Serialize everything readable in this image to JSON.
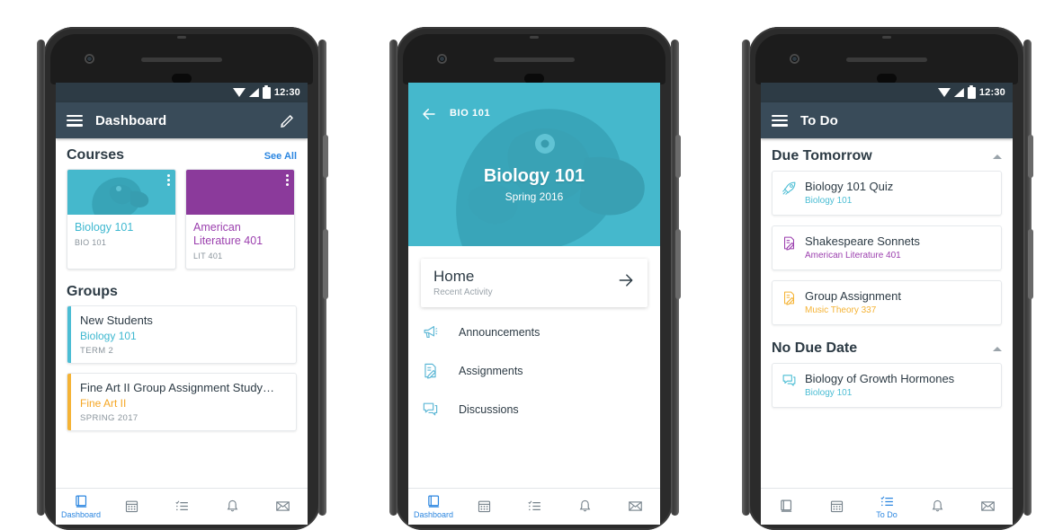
{
  "colors": {
    "statusbar": "#2d3b45",
    "appbar": "#394b59",
    "biology_teal": "#45b8cc",
    "literature_purple": "#8b3a9b",
    "fineart_gold": "#f5a623",
    "link_blue": "#2b86e0",
    "text_dark": "#2d3b45",
    "muted": "#8a949c"
  },
  "phones": [
    {
      "id": "dashboard",
      "statusbar": {
        "time": "12:30",
        "icons": [
          "wifi-icon",
          "signal-icon",
          "battery-icon"
        ]
      },
      "appbar": {
        "menu_icon": "hamburger-icon",
        "title": "Dashboard",
        "action_icon": "pencil-icon"
      },
      "courses_section": {
        "heading": "Courses",
        "see_all": "See All",
        "cards": [
          {
            "name": "Biology 101",
            "code": "BIO 101",
            "color": "#45b8cc",
            "name_color": "#3eb8d0",
            "has_image": true,
            "overflow_icon": "kebab-icon"
          },
          {
            "name": "American Literature 401",
            "code": "LIT 401",
            "color": "#8b3a9b",
            "name_color": "#9b3fae",
            "has_image": false,
            "overflow_icon": "kebab-icon"
          }
        ]
      },
      "groups_section": {
        "heading": "Groups",
        "items": [
          {
            "name": "New Students",
            "course": "Biology 101",
            "term": "TERM 2",
            "color": "#4bbdd4"
          },
          {
            "name": "Fine Art II Group Assignment Study…",
            "course": "Fine Art II",
            "term": "SPRING 2017",
            "color": "#f5b335"
          }
        ]
      },
      "bottomnav": {
        "items": [
          {
            "icon": "dashboard-icon",
            "label": "Dashboard",
            "active": true
          },
          {
            "icon": "calendar-icon",
            "label": "",
            "active": false
          },
          {
            "icon": "todo-list-icon",
            "label": "",
            "active": false
          },
          {
            "icon": "bell-icon",
            "label": "",
            "active": false
          },
          {
            "icon": "envelope-icon",
            "label": "",
            "active": false
          }
        ]
      }
    },
    {
      "id": "course-detail",
      "hero": {
        "back_icon": "arrow-left-icon",
        "breadcrumb": "BIO 101",
        "title": "Biology 101",
        "subtitle": "Spring 2016",
        "color": "#45b8cc"
      },
      "home_card": {
        "title": "Home",
        "subtitle": "Recent Activity",
        "action_icon": "arrow-right-icon"
      },
      "menu": [
        {
          "icon": "announcement-icon",
          "label": "Announcements"
        },
        {
          "icon": "assignment-icon",
          "label": "Assignments"
        },
        {
          "icon": "discussion-icon",
          "label": "Discussions"
        }
      ],
      "bottomnav": {
        "items": [
          {
            "icon": "dashboard-icon",
            "label": "Dashboard",
            "active": true
          },
          {
            "icon": "calendar-icon",
            "label": "",
            "active": false
          },
          {
            "icon": "todo-list-icon",
            "label": "",
            "active": false
          },
          {
            "icon": "bell-icon",
            "label": "",
            "active": false
          },
          {
            "icon": "envelope-icon",
            "label": "",
            "active": false
          }
        ]
      }
    },
    {
      "id": "todo",
      "statusbar": {
        "time": "12:30",
        "icons": [
          "wifi-icon",
          "signal-icon",
          "battery-icon"
        ]
      },
      "appbar": {
        "menu_icon": "hamburger-icon",
        "title": "To Do",
        "action_icon": ""
      },
      "sections": [
        {
          "heading": "Due Tomorrow",
          "collapse_icon": "caret-up-icon",
          "items": [
            {
              "icon": "quiz-rocket-icon",
              "title": "Biology 101 Quiz",
              "course": "Biology 101",
              "color": "#4bbdd4"
            },
            {
              "icon": "assignment-icon",
              "title": "Shakespeare Sonnets",
              "course": "American Literature 401",
              "color": "#9b3fae"
            },
            {
              "icon": "assignment-icon",
              "title": "Group Assignment",
              "course": "Music Theory 337",
              "color": "#f5b335"
            }
          ]
        },
        {
          "heading": "No Due Date",
          "collapse_icon": "caret-up-icon",
          "items": [
            {
              "icon": "discussion-icon",
              "title": "Biology of Growth Hormones",
              "course": "Biology 101",
              "color": "#4bbdd4"
            }
          ]
        }
      ],
      "bottomnav": {
        "items": [
          {
            "icon": "dashboard-icon",
            "label": "",
            "active": false
          },
          {
            "icon": "calendar-icon",
            "label": "",
            "active": false
          },
          {
            "icon": "todo-list-icon",
            "label": "To Do",
            "active": true
          },
          {
            "icon": "bell-icon",
            "label": "",
            "active": false
          },
          {
            "icon": "envelope-icon",
            "label": "",
            "active": false
          }
        ]
      }
    }
  ]
}
